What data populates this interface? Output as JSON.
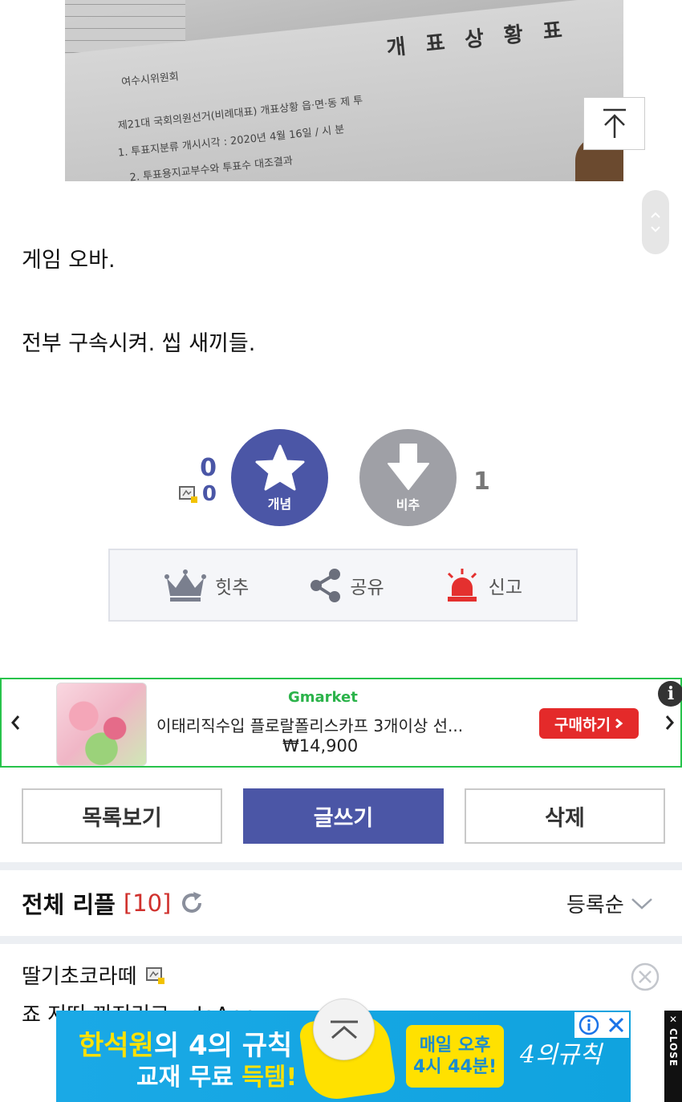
{
  "photo": {
    "title": "개 표 상 황 표",
    "line1": "여수시위원회",
    "line2": "제21대 국회의원선거(비례대표) 개표상황  읍·면·동  제   투",
    "line3": "1. 투표지분류 개시시각 : 2020년 4월 16일 / 시 분",
    "line4": "2. 투표용지교부수와 투표수 대조결과"
  },
  "post": {
    "line1": "게임 오바.",
    "line2": "전부 구속시켜. 씹 새끼들."
  },
  "vote": {
    "up_count": "0",
    "member_count": "0",
    "up_label": "개념",
    "down_label": "비추",
    "down_count": "1"
  },
  "actions": {
    "hot": "힛추",
    "share": "공유",
    "report": "신고"
  },
  "ad": {
    "brand": "Gmarket",
    "title": "이태리직수입 플로랄폴리스카프 3개이상 선...",
    "price": "₩14,900",
    "buy_label": "구매하기",
    "info": "i"
  },
  "buttons": {
    "list": "목록보기",
    "write": "글쓰기",
    "delete": "삭제"
  },
  "replies": {
    "title": "전체 리플",
    "count": "[10]",
    "sort": "등록순"
  },
  "comment": {
    "author": "딸기초코라떼",
    "text": "죠 저떠 끼지리고 . doApp"
  },
  "banner": {
    "headline_a": "한석원",
    "headline_b": "의 4의 규칙",
    "sub_a": "교재 무료 ",
    "sub_b": "득템!",
    "box_line1": "매일 오후",
    "box_line2": "4시 44분!",
    "sign": "4의규칙",
    "close_label": "CLOSE"
  },
  "colors": {
    "primary": "#4b56a6",
    "vote_down": "#9fa0a6",
    "accent_red": "#d0312d",
    "ad_border": "#27c34b",
    "buy_red": "#e42a2a",
    "banner_blue": "#1aa9e6",
    "banner_yellow": "#ffe100"
  },
  "icons": {
    "scroll_top": "arrow-up-bar-icon",
    "scroll": "chevron-up-down-icon",
    "star": "star-icon",
    "thumb_down": "arrow-down-icon",
    "member": "member-badge-icon",
    "crown": "crown-icon",
    "share": "share-icon",
    "siren": "siren-icon",
    "refresh": "refresh-icon",
    "sort": "chevron-down-icon",
    "close": "close-circle-icon"
  }
}
